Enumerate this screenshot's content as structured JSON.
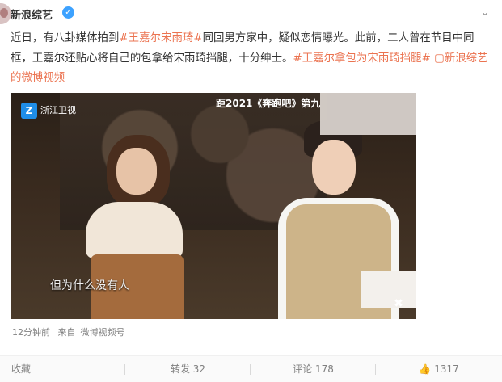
{
  "post": {
    "username": "新浪综艺",
    "verified_icon": "verified-icon",
    "text_lines": [
      "近日，有八卦媒体拍到",
      "#王嘉尔宋雨琦#",
      "同回男方家中，疑似恋情曝光。此前，二人曾在节目中同框，王嘉尔还贴心将自己的包拿给宋雨琦挡腿，十分绅士。",
      "#王嘉尔拿包为宋雨琦挡腿#",
      "新浪综艺的微博视频"
    ],
    "video_link_icon": "video-link-icon"
  },
  "video": {
    "channel": "浙江卫视",
    "program": "距2021《奔跑吧》第九",
    "subtitle": "但为什么没有人"
  },
  "meta": {
    "time": "12分钟前",
    "source_prefix": "来自",
    "source": "微博视频号"
  },
  "actions": {
    "favorite": "收藏",
    "repost": "转发 32",
    "comment": "评论 178",
    "like": "1317"
  },
  "colors": {
    "link": "#eb7350",
    "text": "#333333",
    "meta": "#808080",
    "verified": "#3da2ff"
  }
}
